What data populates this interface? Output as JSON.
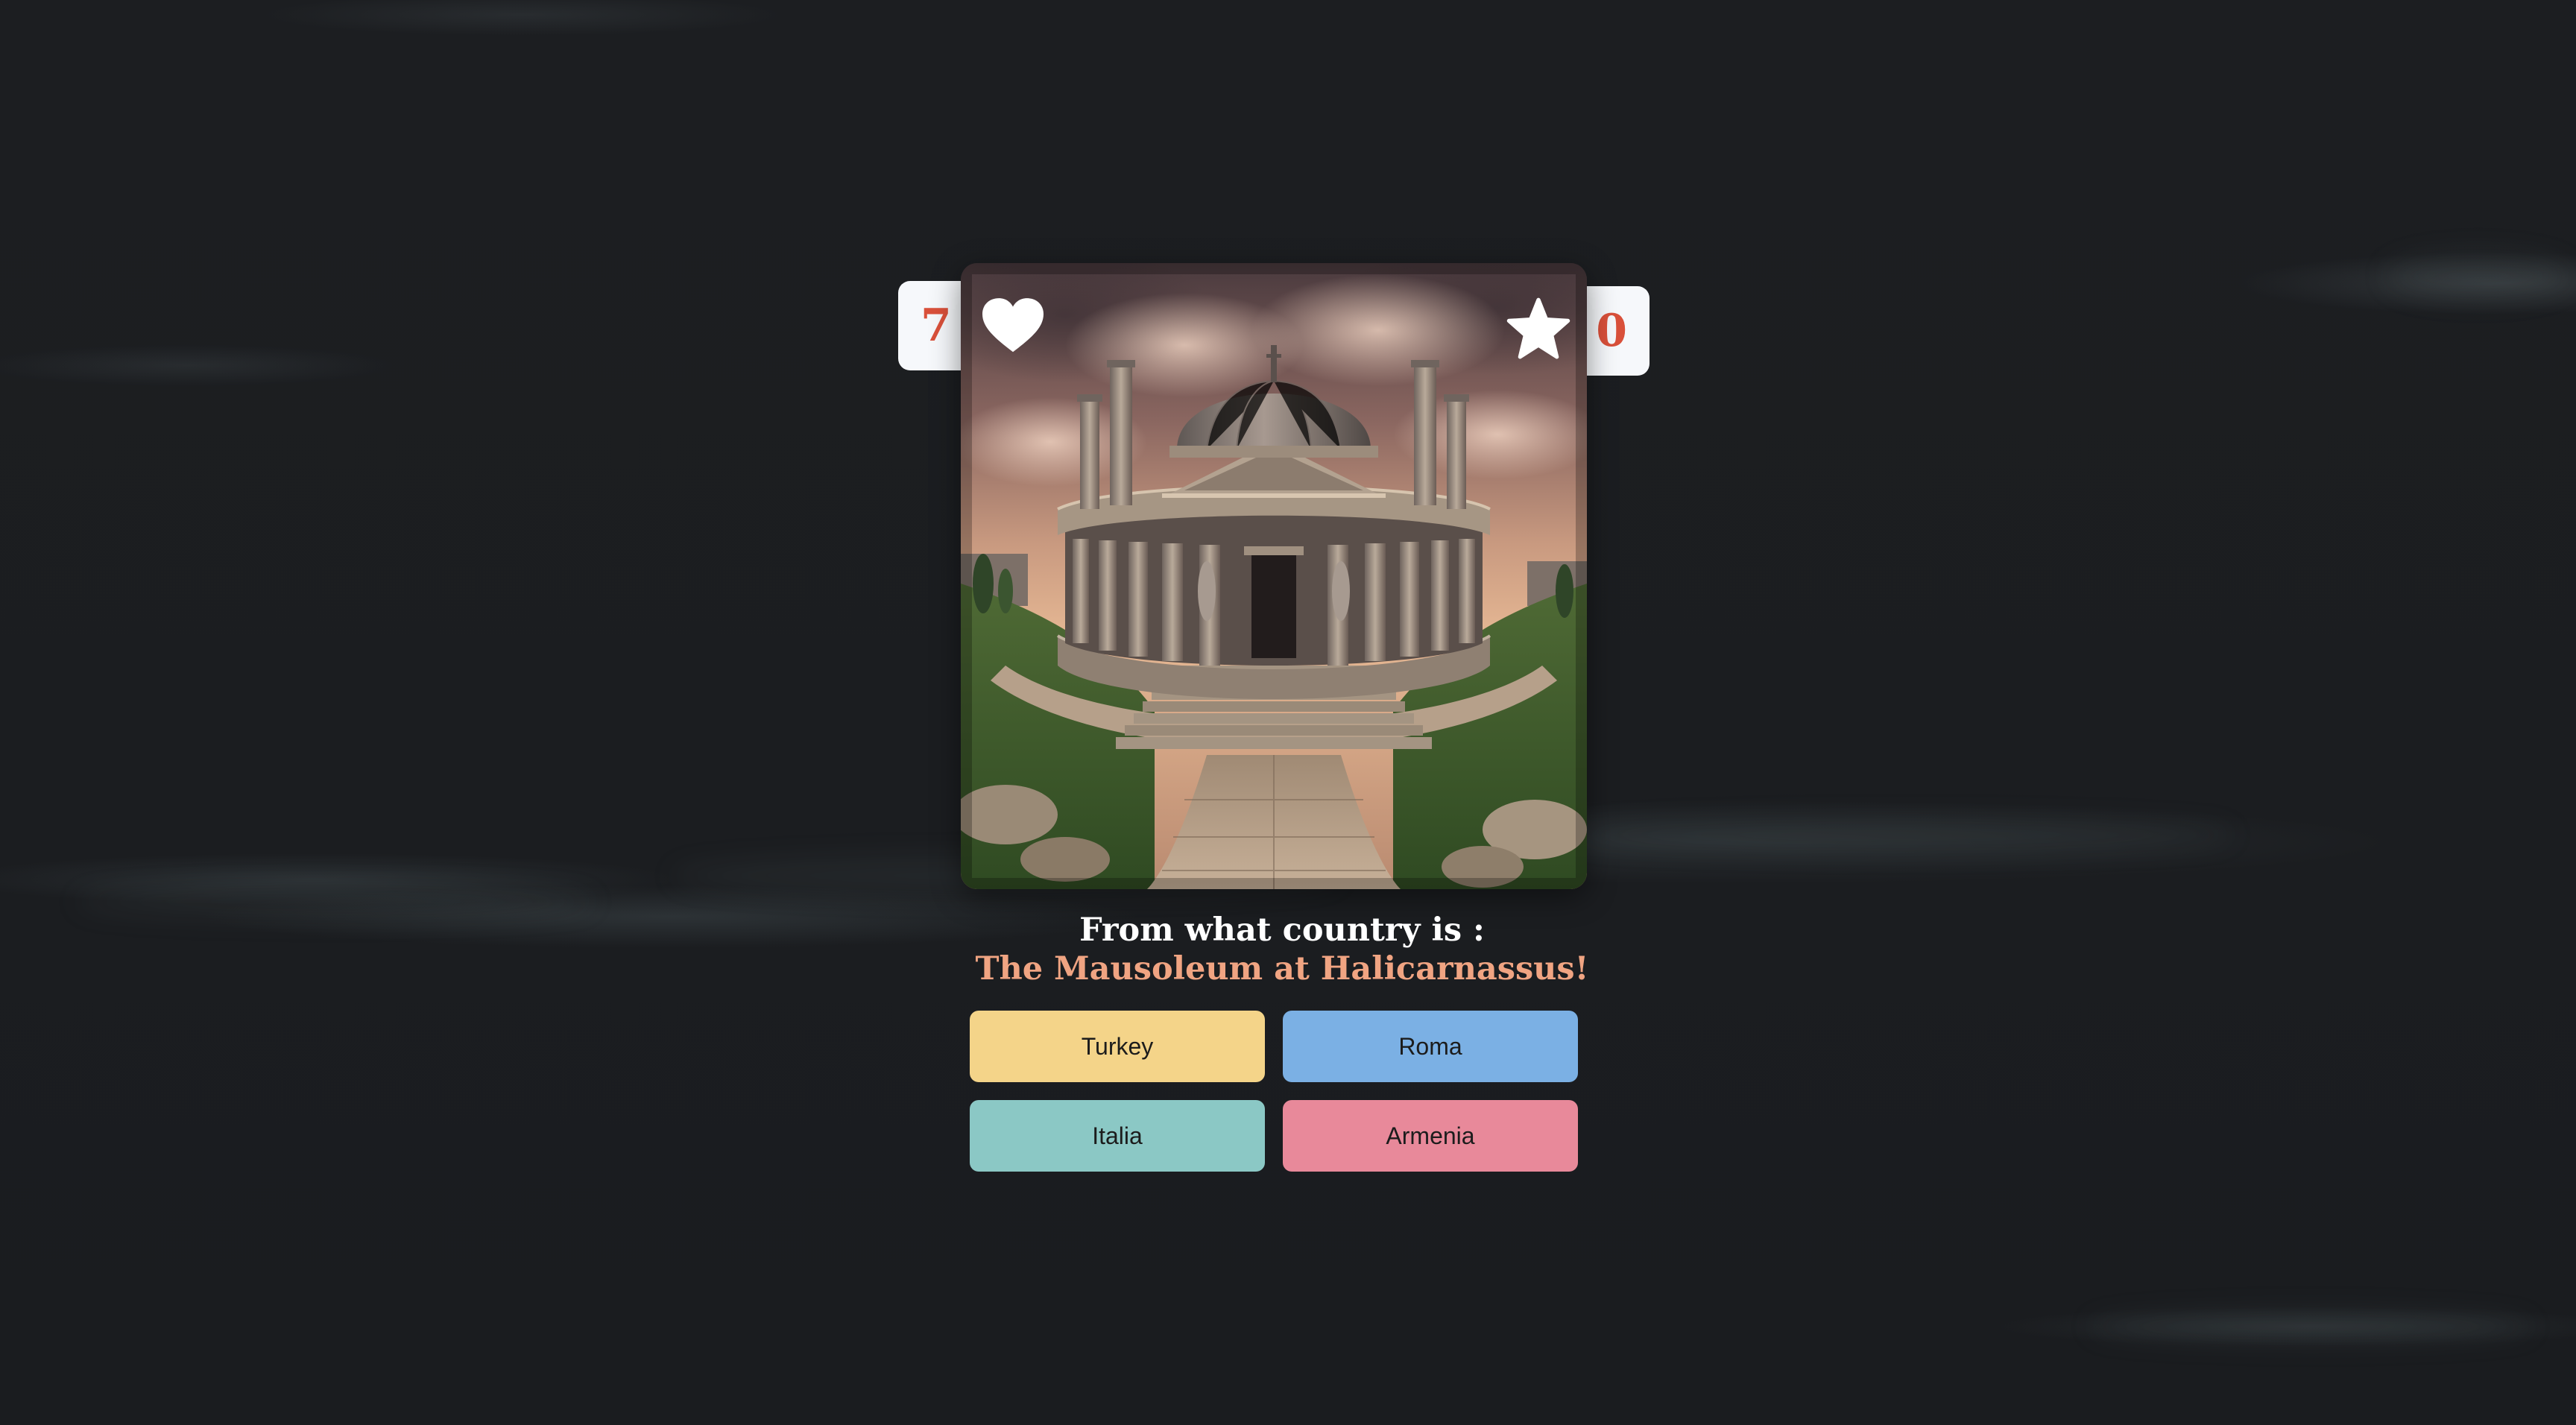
{
  "hud": {
    "lives": "7",
    "lives_icon": "heart-icon",
    "stars": "0",
    "stars_icon": "star-icon",
    "accent_color": "#d9503a"
  },
  "card": {
    "image_subject": "Mausoleum-style domed classical building with colonnade, stairs and a stone path under a dramatic sunset sky"
  },
  "question": {
    "prompt": "From what country is :",
    "subject": "The Mausoleum at Halicarnassus!",
    "subject_color": "#f0a482"
  },
  "answers": [
    {
      "label": "Turkey",
      "color": "#f4d489"
    },
    {
      "label": "Roma",
      "color": "#7bb0e4"
    },
    {
      "label": "Italia",
      "color": "#8bc8c5"
    },
    {
      "label": "Armenia",
      "color": "#e8899a"
    }
  ]
}
